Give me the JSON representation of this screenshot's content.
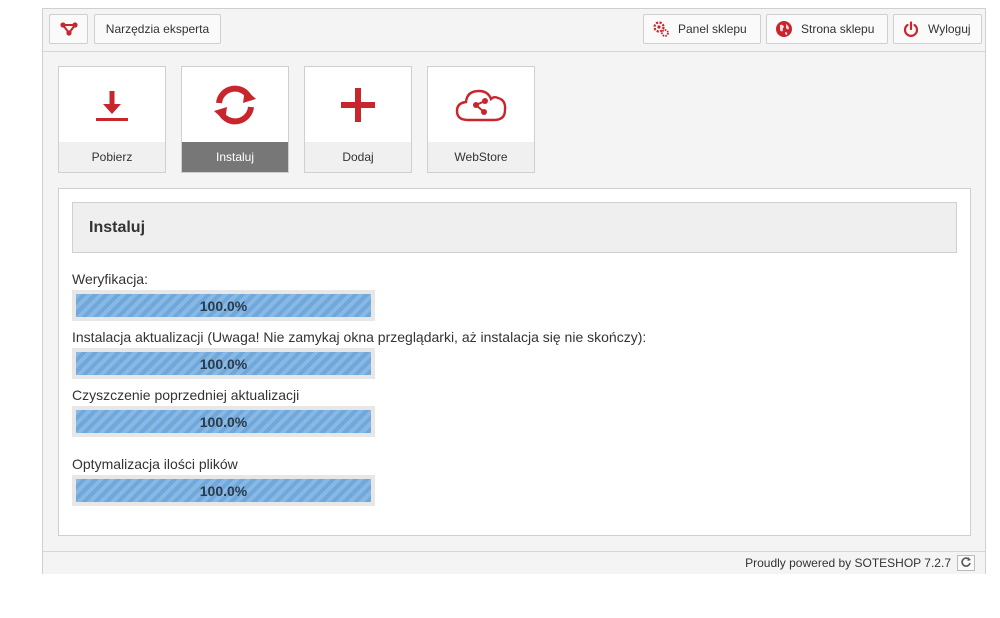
{
  "header": {
    "logo_icon": "network-logo-icon",
    "expert_tools_label": "Narzędzia eksperta",
    "shop_panel_label": "Panel sklepu",
    "shop_site_label": "Strona sklepu",
    "logout_label": "Wyloguj"
  },
  "tiles": [
    {
      "label": "Pobierz",
      "icon": "download-icon",
      "active": false
    },
    {
      "label": "Instaluj",
      "icon": "refresh-icon",
      "active": true
    },
    {
      "label": "Dodaj",
      "icon": "plus-icon",
      "active": false
    },
    {
      "label": "WebStore",
      "icon": "cloud-network-icon",
      "active": false
    }
  ],
  "panel": {
    "title": "Instaluj",
    "steps": [
      {
        "label": "Weryfikacja:",
        "progress": "100.0%"
      },
      {
        "label": "Instalacja aktualizacji (Uwaga! Nie zamykaj okna przeglądarki, aż instalacja się nie skończy):",
        "progress": "100.0%"
      },
      {
        "label": "Czyszczenie poprzedniej aktualizacji",
        "progress": "100.0%"
      },
      {
        "label": "Optymalizacja ilości plików",
        "progress": "100.0%"
      }
    ]
  },
  "footer": {
    "powered_by": "Proudly powered by SOTESHOP 7.2.7"
  },
  "colors": {
    "accent": "#c8262c",
    "progress": "#6fa8dc",
    "active_tile": "#777777"
  }
}
